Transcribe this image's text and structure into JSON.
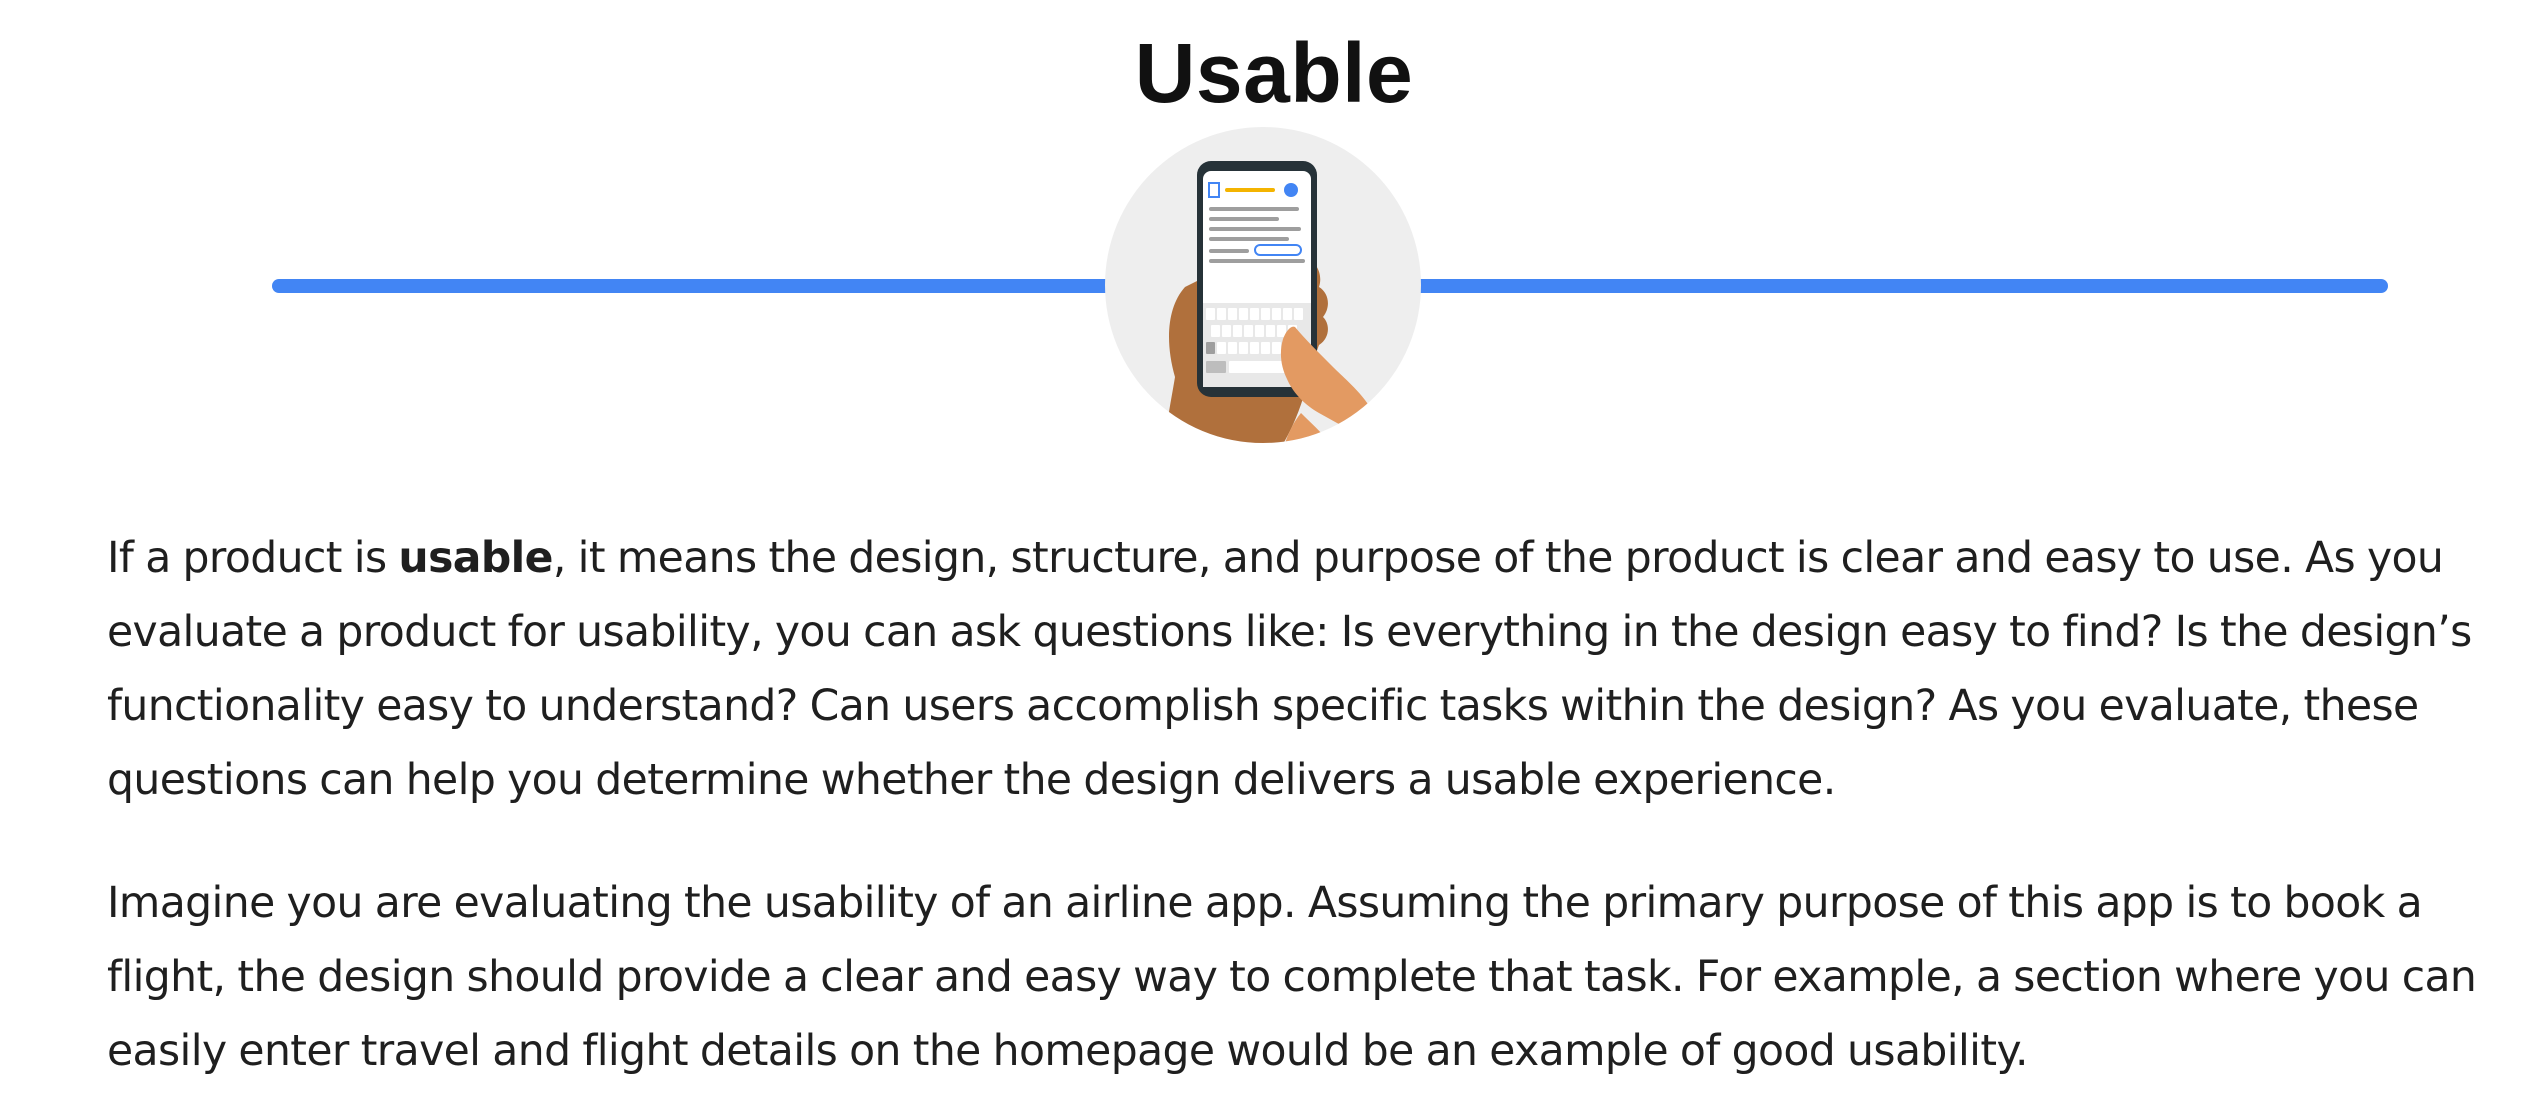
{
  "heading": {
    "title": "Usable"
  },
  "illustration": {
    "icon": "hand-holding-phone-icon",
    "accent_color": "#4285f4",
    "circle_color": "#eeeeee"
  },
  "paragraphs": {
    "p1": {
      "before": "If a product is ",
      "bold": "usable",
      "after": ", it means the design, structure, and purpose of the product is clear and easy to use. As you evaluate a product for usability, you can ask questions like: Is everything in the design easy to find? Is the design’s functionality easy to understand? Can users accomplish specific tasks within the design? As you evaluate, these questions can help you determine whether the design delivers a usable experience."
    },
    "p2": "Imagine you are evaluating the usability of an airline app. Assuming the primary purpose of this app is to book a flight, the design should provide a clear and easy way to complete that task. For example, a section where you can easily enter travel and flight details on the homepage would be an example of good usability."
  }
}
